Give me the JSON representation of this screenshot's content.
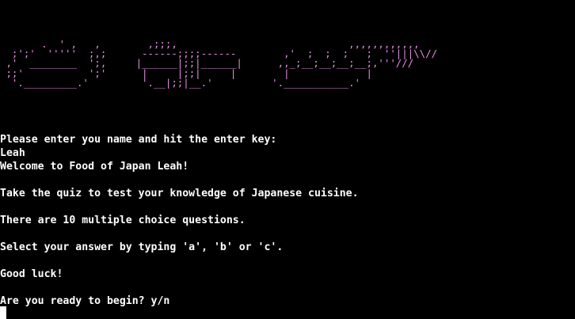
{
  "terminal": {
    "ascii_art": "       .  ' ,   ,        ,;;;,                             ,,,,,,,,,,,,\n  ;';'  '''''  ;,;      ------;;;;------        ,'  ;  ;  ;   ;  ''|||\\\\//\n ,'  ________  ';,     |______|;;|______|      ,,_;__;__;__;__;,'''///\n ;;'           ';'      |     |;;|     |        |             |\n  '._________.'         '.__|;;|__.'          '.___________.'",
    "lines": [
      "Please enter you name and hit the enter key:",
      "Leah",
      "Welcome to Food of Japan Leah!",
      "",
      "Take the quiz to test your knowledge of Japanese cuisine.",
      "",
      "There are 10 multiple choice questions.",
      "",
      "Select your answer by typing 'a', 'b' or 'c'.",
      "",
      "Good luck!",
      "",
      "Are you ready to begin? y/n"
    ]
  },
  "colors": {
    "background": "#000000",
    "text": "#ffffff",
    "ascii_art": "#e48fe3",
    "cursor": "#ffffff"
  }
}
